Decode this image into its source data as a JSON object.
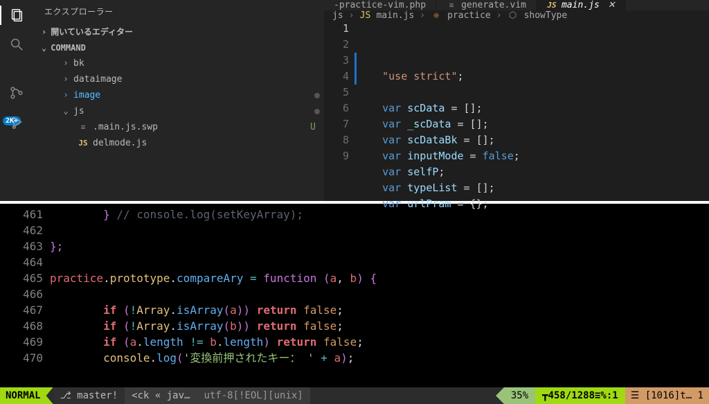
{
  "sidebar": {
    "title": "エクスプローラー",
    "open_editors": "開いているエディター",
    "root": "COMMAND",
    "items": [
      {
        "chev": "›",
        "name": "bk",
        "indent": 1
      },
      {
        "chev": "›",
        "name": "dataimage",
        "indent": 1
      },
      {
        "chev": "›",
        "name": "image",
        "indent": 1,
        "active": true,
        "dot": true
      },
      {
        "chev": "⌄",
        "name": "js",
        "indent": 1,
        "dot": true
      },
      {
        "ico": "swp",
        "icotxt": "≡",
        "name": ".main.js.swp",
        "indent": 2,
        "status": "U"
      },
      {
        "ico": "js",
        "icotxt": "JS",
        "name": "delmode.js",
        "indent": 2
      }
    ]
  },
  "badge": "2K+",
  "tabs": [
    {
      "label": "-practice-vim.php"
    },
    {
      "ico": "≡",
      "label": "generate.vim"
    },
    {
      "ico": "JS",
      "label": "main.js",
      "active": true,
      "close": true
    }
  ],
  "breadcrumb": {
    "a": "js",
    "b": "main.js",
    "c": "practice",
    "d": "showType"
  },
  "editor": {
    "lines": [
      {
        "n": "1",
        "pre": "    ",
        "t": [
          [
            "str",
            "\"use strict\""
          ],
          [
            "op",
            ";"
          ]
        ]
      },
      {
        "n": "2",
        "pre": "",
        "t": []
      },
      {
        "n": "3",
        "pre": "    ",
        "t": [
          [
            "kw",
            "var "
          ],
          [
            "var",
            "scData"
          ],
          [
            "op",
            " = [];"
          ]
        ]
      },
      {
        "n": "4",
        "pre": "    ",
        "t": [
          [
            "kw",
            "var "
          ],
          [
            "var",
            "_scData"
          ],
          [
            "op",
            " = [];"
          ]
        ]
      },
      {
        "n": "5",
        "pre": "    ",
        "t": [
          [
            "kw",
            "var "
          ],
          [
            "var",
            "scDataBk"
          ],
          [
            "op",
            " = [];"
          ]
        ]
      },
      {
        "n": "6",
        "pre": "    ",
        "t": [
          [
            "kw",
            "var "
          ],
          [
            "var",
            "inputMode"
          ],
          [
            "op",
            " = "
          ],
          [
            "bool",
            "false"
          ],
          [
            "op",
            ";"
          ]
        ]
      },
      {
        "n": "7",
        "pre": "    ",
        "t": [
          [
            "kw",
            "var "
          ],
          [
            "var",
            "selfP"
          ],
          [
            "op",
            ";"
          ]
        ]
      },
      {
        "n": "8",
        "pre": "    ",
        "t": [
          [
            "kw",
            "var "
          ],
          [
            "var",
            "typeList"
          ],
          [
            "op",
            " = [];"
          ]
        ]
      },
      {
        "n": "9",
        "pre": "    ",
        "t": [
          [
            "kw",
            "var "
          ],
          [
            "var",
            "urlPram"
          ],
          [
            "op",
            " = {};"
          ]
        ]
      }
    ]
  },
  "term": {
    "lines": [
      {
        "n": "461",
        "html": "        <span class='c-brace'>}</span> <span class='c-comm'>// console.log(setKeyArray);</span>"
      },
      {
        "n": "462",
        "html": ""
      },
      {
        "n": "463",
        "html": "<span class='c-brace'>};</span>"
      },
      {
        "n": "464",
        "html": ""
      },
      {
        "n": "465",
        "html": "<span class='c-obj'>practice</span>.<span class='c-proto'>prototype</span>.<span class='c-fn'>compareAry</span> <span class='c-op'>=</span> <span class='c-kw'>function</span> <span class='c-brace'>(</span><span class='c-param'>a</span>, <span class='c-param'>b</span><span class='c-brace'>)</span> <span class='c-brace'>{</span>"
      },
      {
        "n": "466",
        "html": ""
      },
      {
        "n": "467",
        "html": "        <span class='c-kwr'>if</span> <span class='c-brace'>(</span><span class='c-op'>!</span><span class='c-proto'>Array</span>.<span class='c-fn'>isArray</span><span class='c-brace'>(</span><span class='c-param'>a</span><span class='c-brace'>))</span> <span class='c-kwr'>return</span> <span class='c-false'>false</span>;"
      },
      {
        "n": "468",
        "html": "        <span class='c-kwr'>if</span> <span class='c-brace'>(</span><span class='c-op'>!</span><span class='c-proto'>Array</span>.<span class='c-fn'>isArray</span><span class='c-brace'>(</span><span class='c-param'>b</span><span class='c-brace'>))</span> <span class='c-kwr'>return</span> <span class='c-false'>false</span>;"
      },
      {
        "n": "469",
        "html": "        <span class='c-kwr'>if</span> <span class='c-brace'>(</span><span class='c-param'>a</span>.<span class='c-fn'>length</span> <span class='c-op'>!=</span> <span class='c-param'>b</span>.<span class='c-fn'>length</span><span class='c-brace'>)</span> <span class='c-kwr'>return</span> <span class='c-false'>false</span>;"
      },
      {
        "n": "470",
        "html": "        <span class='c-cons'>console</span>.<span class='c-fn'>log</span><span class='c-brace'>(</span><span class='c-str'>'変換前押されたキー： '</span> <span class='c-op'>+</span> <span class='c-param'>a</span><span class='c-brace'>)</span>;"
      }
    ]
  },
  "status": {
    "mode": "NORMAL",
    "branch": "⎇ master!",
    "file": "<ck « jav…",
    "enc": "utf-8[!EOL][unix]",
    "pct": "35%",
    "pos": "┳458/1288≡%:1",
    "info": "☰  [1016]t… 1"
  }
}
